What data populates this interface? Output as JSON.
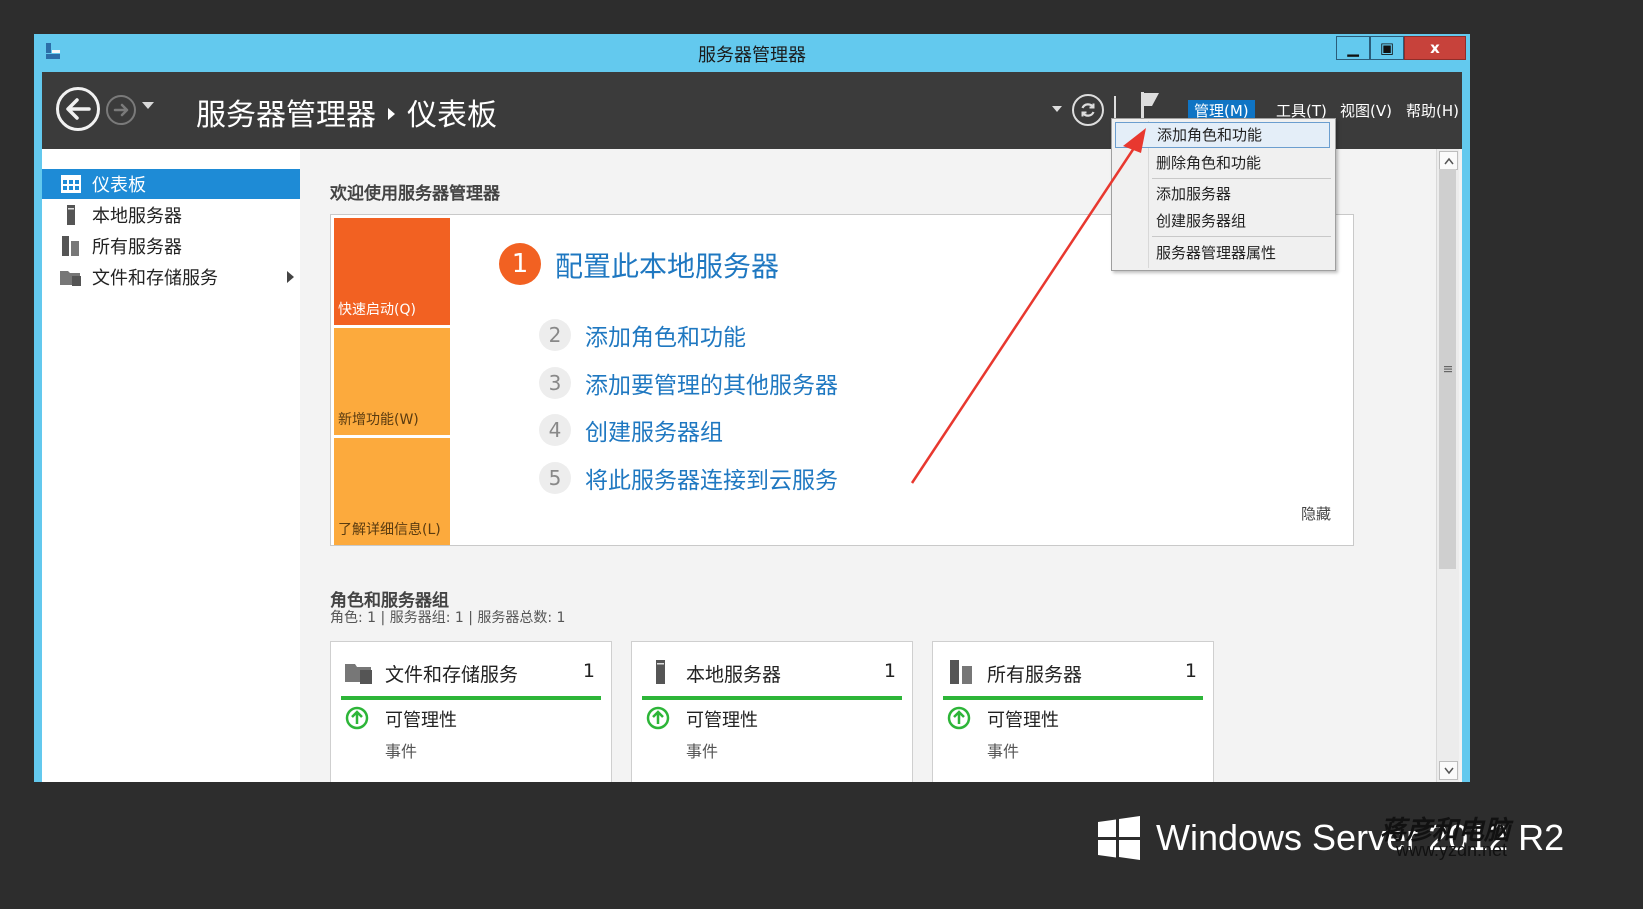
{
  "window": {
    "title": "服务器管理器",
    "controls": {
      "minimize": "▁",
      "maximize": "▣",
      "close": "x"
    }
  },
  "header": {
    "breadcrumb_app": "服务器管理器",
    "breadcrumb_page": "仪表板",
    "menus": {
      "manage": "管理(M)",
      "tools": "工具(T)",
      "view": "视图(V)",
      "help": "帮助(H)"
    }
  },
  "manage_menu": {
    "items": [
      "添加角色和功能",
      "删除角色和功能",
      "添加服务器",
      "创建服务器组",
      "服务器管理器属性"
    ]
  },
  "sidebar": {
    "items": [
      {
        "label": "仪表板",
        "icon": "dashboard-icon"
      },
      {
        "label": "本地服务器",
        "icon": "server-icon"
      },
      {
        "label": "所有服务器",
        "icon": "servers-icon"
      },
      {
        "label": "文件和存储服务",
        "icon": "file-storage-icon"
      }
    ]
  },
  "welcome": {
    "title": "欢迎使用服务器管理器",
    "tiles": {
      "quick_start": "快速启动(Q)",
      "new_features": "新增功能(W)",
      "learn_more": "了解详细信息(L)"
    },
    "step1_number": "1",
    "step1_label": "配置此本地服务器",
    "steps": [
      {
        "number": "2",
        "label": "添加角色和功能"
      },
      {
        "number": "3",
        "label": "添加要管理的其他服务器"
      },
      {
        "number": "4",
        "label": "创建服务器组"
      },
      {
        "number": "5",
        "label": "将此服务器连接到云服务"
      }
    ],
    "hide": "隐藏"
  },
  "roles": {
    "title": "角色和服务器组",
    "subtitle": "角色: 1 | 服务器组: 1 | 服务器总数: 1",
    "cards": [
      {
        "title": "文件和存储服务",
        "count": "1",
        "manageability": "可管理性",
        "events": "事件"
      },
      {
        "title": "本地服务器",
        "count": "1",
        "manageability": "可管理性",
        "events": "事件"
      },
      {
        "title": "所有服务器",
        "count": "1",
        "manageability": "可管理性",
        "events": "事件"
      }
    ]
  },
  "brand": {
    "product": "Windows Server 2012 R2"
  },
  "watermark": {
    "cn": "蒋彦和电脑",
    "url": "www.yzdn.net"
  },
  "colors": {
    "titlebar": "#63c9ee",
    "topbar": "#3b3b3b",
    "accent": "#1e8bd6",
    "quick_start_tile": "#f26122",
    "feature_tile": "#fcaa3d",
    "status_ok": "#2db538",
    "annotation_arrow": "#e8382f"
  }
}
